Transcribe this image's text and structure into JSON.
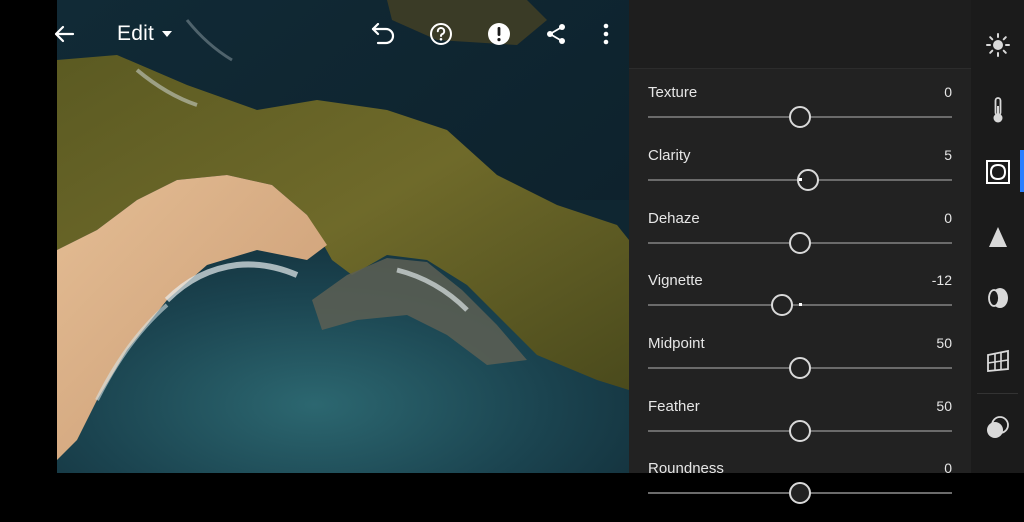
{
  "header": {
    "edit_label": "Edit"
  },
  "panel": {
    "sliders": [
      {
        "label": "Texture",
        "value": "0",
        "fraction": 0.5
      },
      {
        "label": "Clarity",
        "value": "5",
        "fraction": 0.525
      },
      {
        "label": "Dehaze",
        "value": "0",
        "fraction": 0.5
      },
      {
        "label": "Vignette",
        "value": "-12",
        "fraction": 0.44
      },
      {
        "label": "Midpoint",
        "value": "50",
        "fraction": 0.5
      },
      {
        "label": "Feather",
        "value": "50",
        "fraction": 0.5
      },
      {
        "label": "Roundness",
        "value": "0",
        "fraction": 0.5
      }
    ]
  },
  "tools": [
    {
      "name": "light-icon"
    },
    {
      "name": "color-temperature-icon"
    },
    {
      "name": "effects-icon",
      "active": true
    },
    {
      "name": "detail-icon"
    },
    {
      "name": "optics-icon"
    },
    {
      "name": "geometry-icon"
    },
    {
      "name": "presets-icon"
    }
  ],
  "colors": {
    "accent": "#2a7fff",
    "panel_bg": "#222222"
  }
}
